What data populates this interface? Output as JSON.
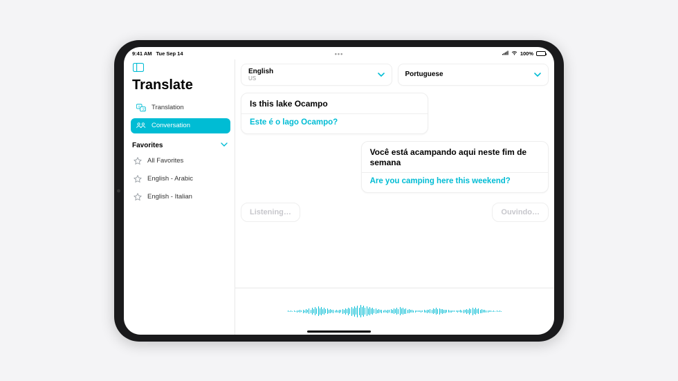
{
  "statusbar": {
    "time": "9:41 AM",
    "date": "Tue Sep 14",
    "battery_pct": "100%"
  },
  "sidebar": {
    "app_title": "Translate",
    "nav": {
      "translation": "Translation",
      "conversation": "Conversation"
    },
    "favorites_title": "Favorites",
    "favorites": [
      "All Favorites",
      "English - Arabic",
      "English - Italian"
    ]
  },
  "languages": {
    "source": {
      "name": "English",
      "region": "US"
    },
    "target": {
      "name": "Portuguese",
      "region": ""
    }
  },
  "conversation": [
    {
      "side": "left",
      "original": "Is this lake Ocampo",
      "translated": "Este é o lago Ocampo?"
    },
    {
      "side": "right",
      "original": "Você está acampando aqui neste fim de semana",
      "translated": "Are you camping here this weekend?"
    }
  ],
  "listening": {
    "left": "Listening…",
    "right": "Ouvindo…"
  }
}
